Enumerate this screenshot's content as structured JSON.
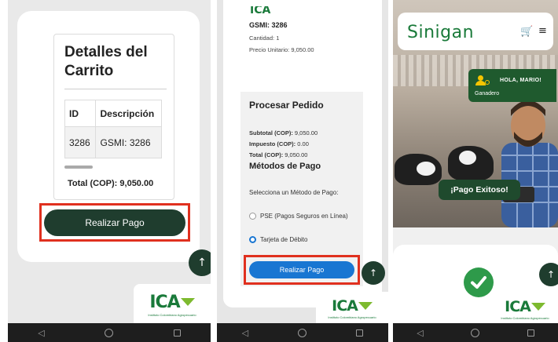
{
  "colors": {
    "dark_green": "#1f3d2e",
    "highlight_red": "#e0301e",
    "primary_blue": "#1976d2",
    "brand_green": "#1a7a3a"
  },
  "ica_logo": {
    "text": "ICA",
    "subtitle": "Instituto Colombiano Agropecuario",
    "icon": "ica-leaf-logo"
  },
  "navbar": {
    "icons": [
      "back-icon",
      "home-icon",
      "recents-icon"
    ]
  },
  "screen1": {
    "title": "Detalles del Carrito",
    "table": {
      "headers": [
        "ID",
        "Descripción"
      ],
      "rows": [
        [
          "3286",
          "GSMI: 3286"
        ]
      ]
    },
    "total": "Total (COP): 9,050.00",
    "pay_button": "Realizar Pago",
    "scroll_top_icon": "arrow-up-icon"
  },
  "screen2": {
    "top_logo": "ICA",
    "product": "GSMI: 3286",
    "quantity": "Cantidad: 1",
    "unit_price": "Precio Unitario: 9,050.00",
    "process_title": "Procesar Pedido",
    "subtotal_label": "Subtotal (COP):",
    "subtotal_value": "9,050.00",
    "tax_label": "Impuesto (COP):",
    "tax_value": "0.00",
    "total_label": "Total (COP):",
    "total_value": "9,050.00",
    "methods_title": "Métodos de Pago",
    "select_prompt": "Selecciona un Método de Pago:",
    "options": [
      {
        "label": "PSE (Pagos Seguros en Línea)",
        "selected": false
      },
      {
        "label": "Tarjeta de Débito",
        "selected": true
      }
    ],
    "pay_button": "Realizar Pago"
  },
  "screen3": {
    "logo": "Sinigan",
    "cart_icon": "cart-icon",
    "menu_icon": "menu-icon",
    "greeting": "HOLA, MARIO!",
    "role": "Ganadero",
    "toast": "¡Pago Exitoso!",
    "success_icon": "check-circle-icon"
  }
}
